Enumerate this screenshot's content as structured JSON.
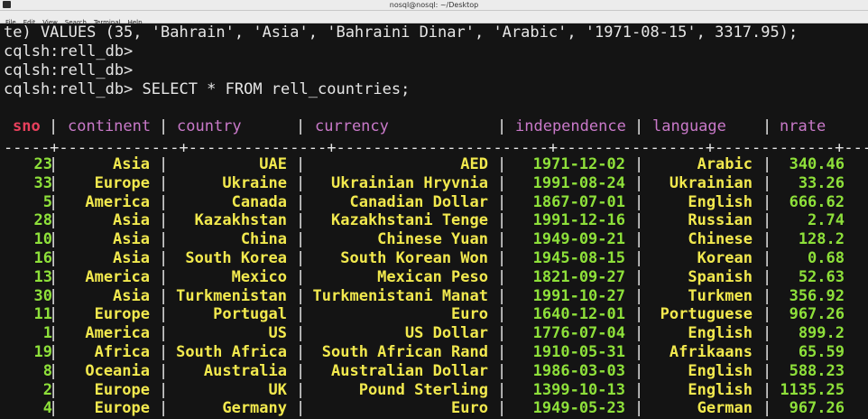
{
  "window": {
    "title": "nosql@nosql: ~/Desktop"
  },
  "menu": [
    "File",
    "Edit",
    "View",
    "Search",
    "Terminal",
    "Help"
  ],
  "terminal": {
    "lines": [
      "te) VALUES (35, 'Bahrain', 'Asia', 'Bahraini Dinar', 'Arabic', '1971-08-15', 3317.95);",
      "cqlsh:rell_db>",
      "cqlsh:rell_db>",
      "cqlsh:rell_db> SELECT * FROM rell_countries;"
    ],
    "separator": "-----+-------------+---------------+-----------------------+----------------+-------------+---------",
    "headers": [
      "sno",
      "continent",
      "country",
      "currency",
      "independence",
      "language",
      "nrate"
    ],
    "rows": [
      [
        "23",
        "Asia",
        "UAE",
        "AED",
        "1971-12-02",
        "Arabic",
        "340.46"
      ],
      [
        "33",
        "Europe",
        "Ukraine",
        "Ukrainian Hryvnia",
        "1991-08-24",
        "Ukrainian",
        "33.26"
      ],
      [
        "5",
        "America",
        "Canada",
        "Canadian Dollar",
        "1867-07-01",
        "English",
        "666.62"
      ],
      [
        "28",
        "Asia",
        "Kazakhstan",
        "Kazakhstani Tenge",
        "1991-12-16",
        "Russian",
        "2.74"
      ],
      [
        "10",
        "Asia",
        "China",
        "Chinese Yuan",
        "1949-09-21",
        "Chinese",
        "128.2"
      ],
      [
        "16",
        "Asia",
        "South Korea",
        "South Korean Won",
        "1945-08-15",
        "Korean",
        "0.68"
      ],
      [
        "13",
        "America",
        "Mexico",
        "Mexican Peso",
        "1821-09-27",
        "Spanish",
        "52.63"
      ],
      [
        "30",
        "Asia",
        "Turkmenistan",
        "Turkmenistani Manat",
        "1991-10-27",
        "Turkmen",
        "356.92"
      ],
      [
        "11",
        "Europe",
        "Portugal",
        "Euro",
        "1640-12-01",
        "Portuguese",
        "967.26"
      ],
      [
        "1",
        "America",
        "US",
        "US Dollar",
        "1776-07-04",
        "English",
        "899.2"
      ],
      [
        "19",
        "Africa",
        "South Africa",
        "South African Rand",
        "1910-05-31",
        "Afrikaans",
        "65.59"
      ],
      [
        "8",
        "Oceania",
        "Australia",
        "Australian Dollar",
        "1986-03-03",
        "English",
        "588.23"
      ],
      [
        "2",
        "Europe",
        "UK",
        "Pound Sterling",
        "1399-10-13",
        "English",
        "1135.25"
      ],
      [
        "4",
        "Europe",
        "Germany",
        "Euro",
        "1949-05-23",
        "German",
        "967.26"
      ]
    ]
  },
  "colors": {
    "background": "#141414",
    "text": "#e6e6e6",
    "header_sno": "#e8405c",
    "header": "#c979c9",
    "value": "#f2e94e",
    "number": "#8ee03a"
  }
}
